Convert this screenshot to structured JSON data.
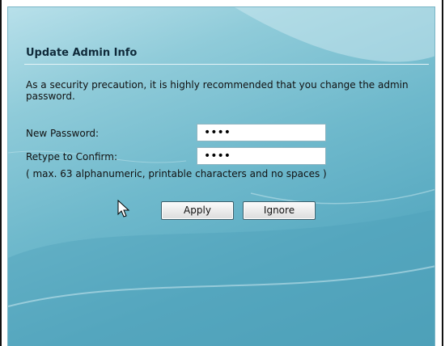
{
  "dialog": {
    "title": "Update Admin Info",
    "message": "As a security precaution, it is highly recommended that you change the admin password.",
    "note": "( max. 63 alphanumeric, printable characters and no spaces )"
  },
  "fields": {
    "new_password": {
      "label": "New Password:",
      "value": "••••"
    },
    "retype_password": {
      "label": "Retype to Confirm:",
      "value": "••••"
    }
  },
  "buttons": {
    "apply_label": "Apply",
    "ignore_label": "Ignore"
  },
  "colors": {
    "panel_light": "#b8e0ea",
    "panel_dark": "#4fa2ba",
    "title_rule": "#e6f4f8"
  },
  "icons": {
    "pointer": "arrow-cursor-icon"
  }
}
